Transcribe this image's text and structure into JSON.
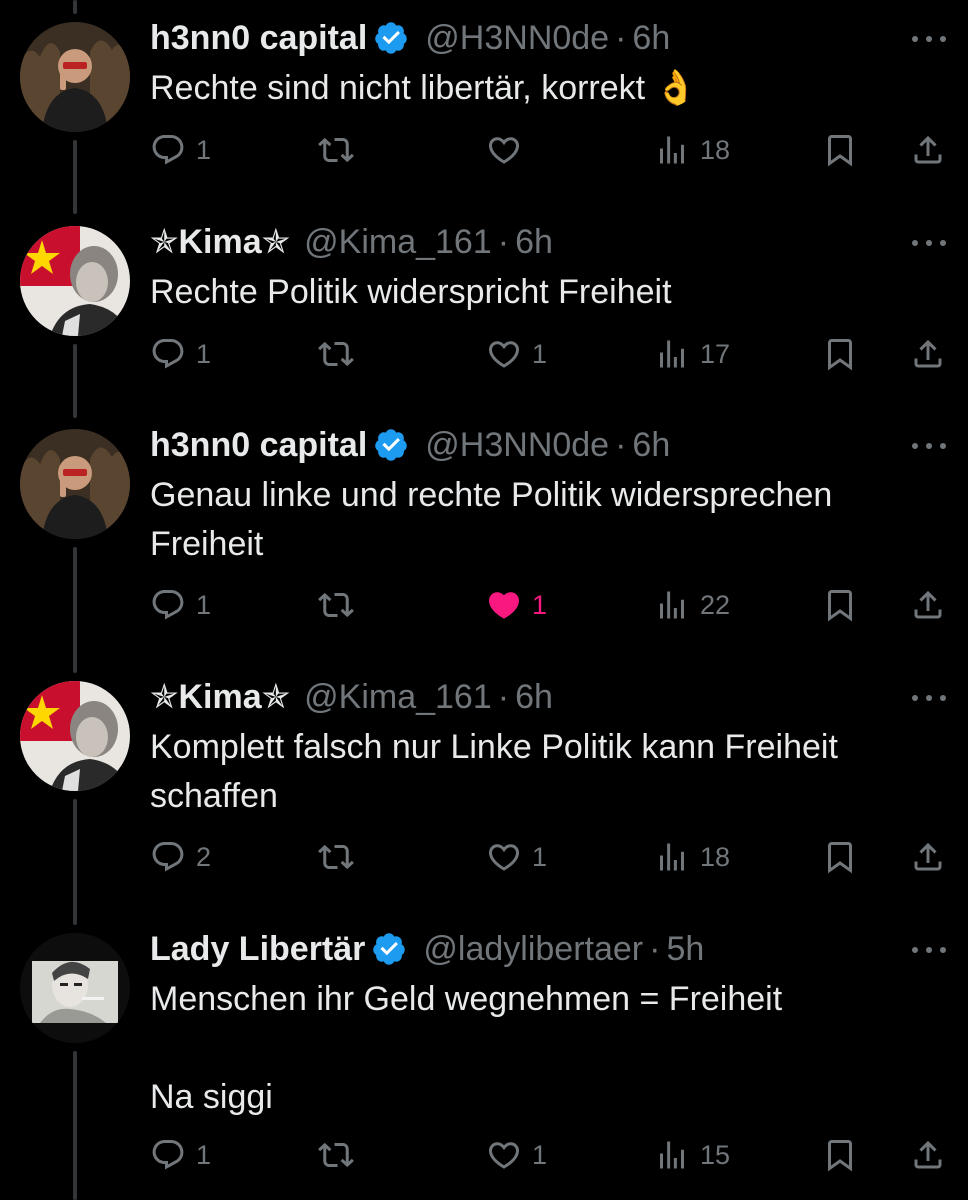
{
  "colors": {
    "background": "#000000",
    "text": "#e7e9ea",
    "muted": "#71767b",
    "verified": "#1d9bf0",
    "like_active": "#f91880",
    "thread_line": "#333639"
  },
  "icons": {
    "reply": "reply-icon",
    "retweet": "retweet-icon",
    "like": "heart-icon",
    "views": "views-icon",
    "bookmark": "bookmark-icon",
    "share": "share-icon",
    "more": "more-icon",
    "verified": "verified-badge-icon"
  },
  "tweets": [
    {
      "name": "h3nn0 capital",
      "verified": true,
      "handle": "@H3NN0de",
      "time": "6h",
      "text": "Rechte sind nicht libertär, korrekt 👌",
      "replies": "1",
      "retweets": "",
      "likes": "",
      "liked": false,
      "views": "18"
    },
    {
      "name": "✯Kima✯",
      "verified": false,
      "handle": "@Kima_161",
      "time": "6h",
      "text": "Rechte Politik widerspricht Freiheit",
      "replies": "1",
      "retweets": "",
      "likes": "1",
      "liked": false,
      "views": "17"
    },
    {
      "name": "h3nn0 capital",
      "verified": true,
      "handle": "@H3NN0de",
      "time": "6h",
      "text": "Genau linke und rechte Politik widersprechen\nFreiheit",
      "replies": "1",
      "retweets": "",
      "likes": "1",
      "liked": true,
      "views": "22"
    },
    {
      "name": "✯Kima✯",
      "verified": false,
      "handle": "@Kima_161",
      "time": "6h",
      "text": "Komplett falsch nur Linke Politik kann Freiheit\nschaffen",
      "replies": "2",
      "retweets": "",
      "likes": "1",
      "liked": false,
      "views": "18"
    },
    {
      "name": "Lady Libertär",
      "verified": true,
      "handle": "@ladylibertaer",
      "time": "5h",
      "text": "Menschen ihr Geld wegnehmen = Freiheit\n\nNa siggi",
      "replies": "1",
      "retweets": "",
      "likes": "1",
      "liked": false,
      "views": "15"
    }
  ]
}
